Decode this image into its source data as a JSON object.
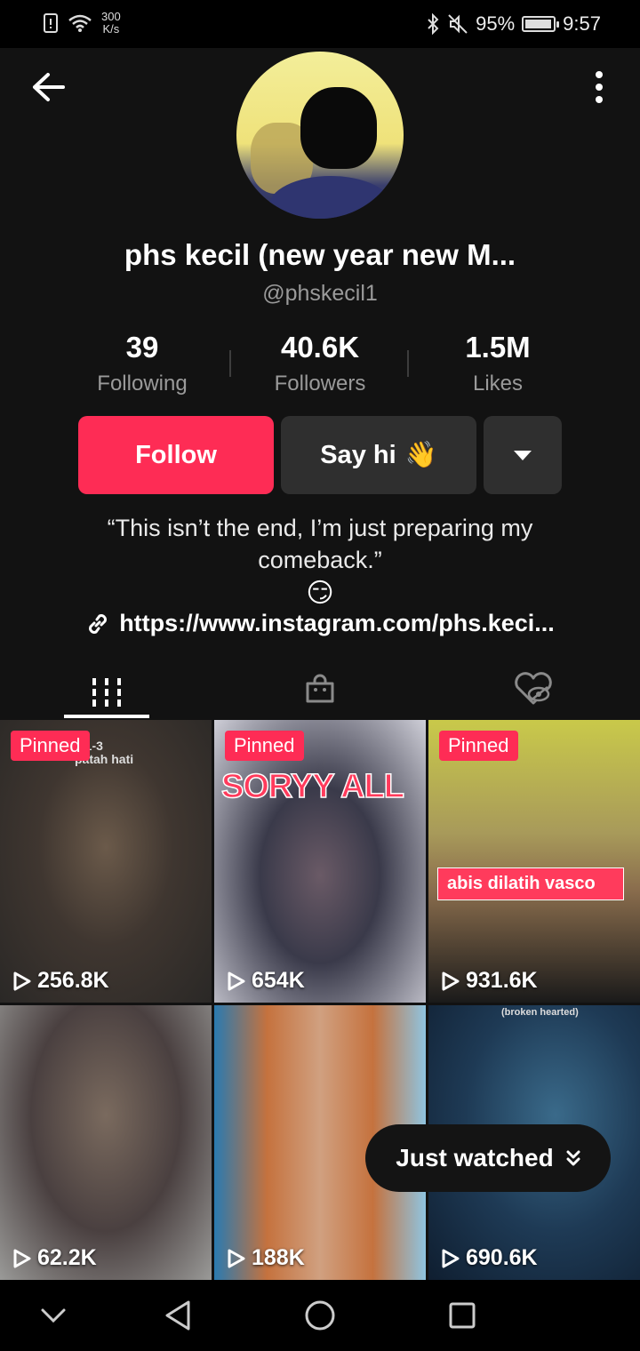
{
  "status_bar": {
    "speed_value": "300",
    "speed_unit": "K/s",
    "battery": "95%",
    "battery_level": 0.95,
    "time": "9:57"
  },
  "profile": {
    "display_name": "phs kecil (new year new M...",
    "handle": "@phskecil1",
    "stats": [
      {
        "value": "39",
        "label": "Following"
      },
      {
        "value": "40.6K",
        "label": "Followers"
      },
      {
        "value": "1.5M",
        "label": "Likes"
      }
    ],
    "follow_label": "Follow",
    "say_hi_label": "Say hi",
    "say_hi_emoji": "👋",
    "bio": "“This isn’t the end, I’m just preparing my comeback.”",
    "bio_emoji": "😏",
    "link": "https://www.instagram.com/phs.keci..."
  },
  "tabs": [
    {
      "icon": "videos-grid-icon",
      "active": true
    },
    {
      "icon": "shop-bag-icon",
      "active": false
    },
    {
      "icon": "liked-hidden-icon",
      "active": false
    }
  ],
  "videos": [
    {
      "views": "256.8K",
      "pinned": true,
      "pinned_label": "Pinned",
      "overlay": "y 1-3\npatah hati"
    },
    {
      "views": "654K",
      "pinned": true,
      "pinned_label": "Pinned",
      "overlay": "SORYY ALL"
    },
    {
      "views": "931.6K",
      "pinned": true,
      "pinned_label": "Pinned",
      "overlay": "abis dilatih vasco"
    },
    {
      "views": "62.2K",
      "pinned": false,
      "overlay": ""
    },
    {
      "views": "188K",
      "pinned": false,
      "overlay": ""
    },
    {
      "views": "690.6K",
      "pinned": false,
      "overlay": "(broken hearted)"
    }
  ],
  "just_watched_label": "Just watched",
  "colors": {
    "accent": "#fe2c55",
    "background": "#121212",
    "button_dark": "#2f2f2f"
  }
}
